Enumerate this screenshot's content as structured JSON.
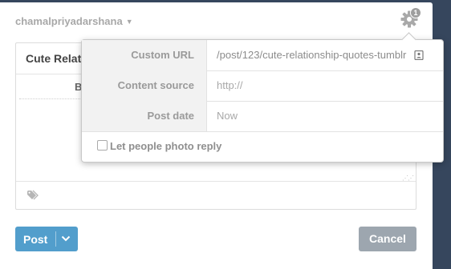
{
  "header": {
    "blog_name": "chamalpriyadarshana",
    "caret": "▼",
    "gear_badge": "1",
    "gear_icon": "gear-icon"
  },
  "editor": {
    "title_visible": "Cute Relat",
    "toolbar_visible_letter": "B",
    "tag_icon": "tag-icon"
  },
  "settings_popover": {
    "rows": [
      {
        "label": "Custom URL",
        "value": "/post/123/cute-relationship-quotes-tumblr",
        "icon": "id-card-icon"
      },
      {
        "label": "Content source",
        "placeholder": "http://"
      },
      {
        "label": "Post date",
        "placeholder": "Now"
      }
    ],
    "photo_reply_label": "Let people photo reply",
    "photo_reply_checked": false
  },
  "footer": {
    "post_label": "Post",
    "cancel_label": "Cancel"
  },
  "colors": {
    "background": "#36465d",
    "post_button": "#529ecc",
    "cancel_button": "#9da6af"
  }
}
